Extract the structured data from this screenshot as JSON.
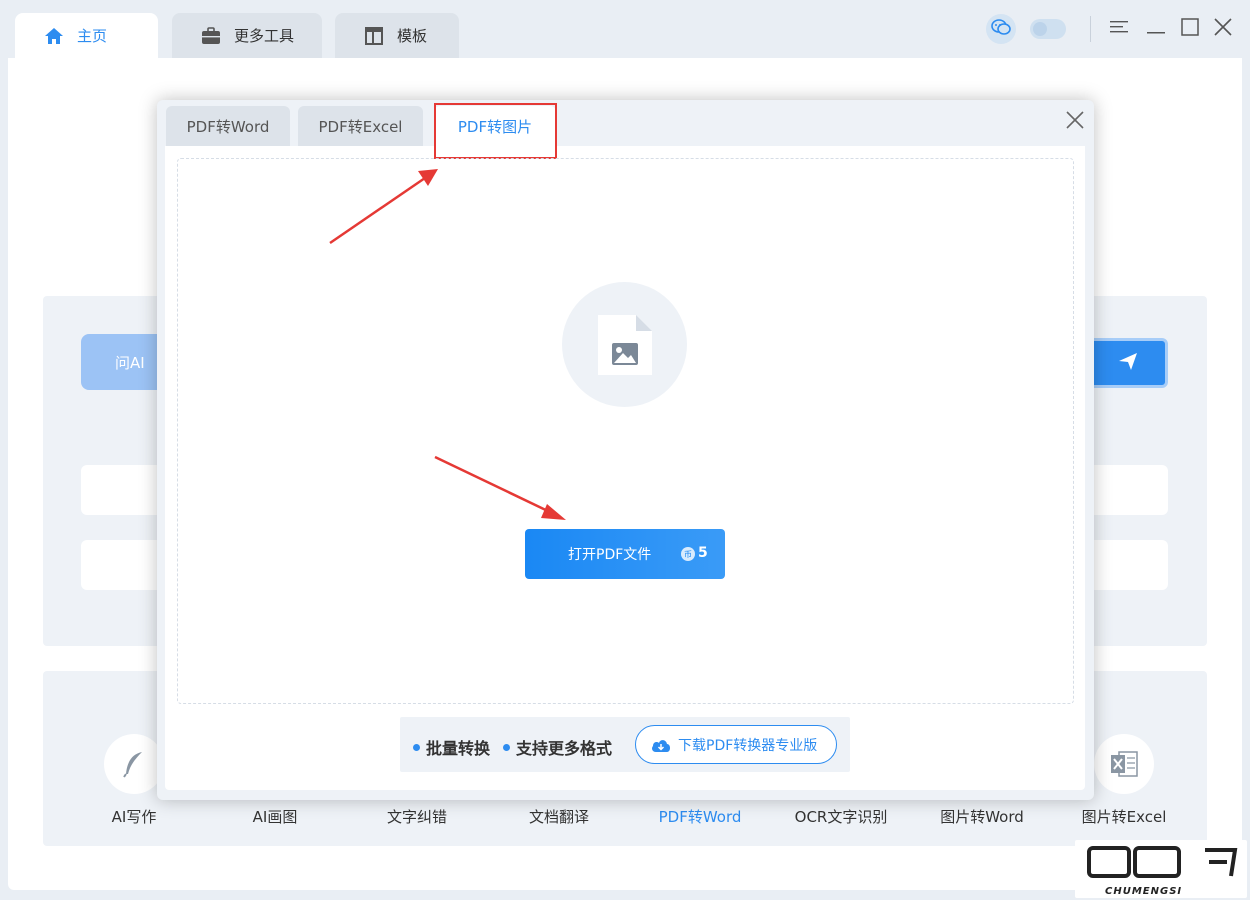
{
  "top_tabs": [
    {
      "label": "主页",
      "icon": "home-icon",
      "active": true
    },
    {
      "label": "更多工具",
      "icon": "toolbox-icon",
      "active": false
    },
    {
      "label": "模板",
      "icon": "template-icon",
      "active": false
    }
  ],
  "window_controls": [
    "wechat-icon",
    "toggle",
    "menu-icon",
    "minimize-icon",
    "maximize-icon",
    "close-icon"
  ],
  "main": {
    "ask_ai_label": "问AI",
    "tools": [
      {
        "label": "AI写作",
        "icon": "feather-icon"
      },
      {
        "label": "AI画图",
        "icon": "paint-icon"
      },
      {
        "label": "文字纠错",
        "icon": "check-icon"
      },
      {
        "label": "文档翻译",
        "icon": "translate-icon"
      },
      {
        "label": "PDF转Word",
        "icon": "pdf-word-icon"
      },
      {
        "label": "OCR文字识别",
        "icon": "ocr-icon"
      },
      {
        "label": "图片转Word",
        "icon": "image-word-icon"
      },
      {
        "label": "图片转Excel",
        "icon": "excel-icon"
      }
    ]
  },
  "modal": {
    "tabs": [
      "PDF转Word",
      "PDF转Excel",
      "PDF转图片"
    ],
    "active_tab": "PDF转图片",
    "open_button_label": "打开PDF文件",
    "coin_symbol": "币",
    "cost": "5",
    "features": [
      "批量转换",
      "支持更多格式"
    ],
    "download_label": "下载PDF转换器专业版"
  },
  "watermark": {
    "text": "CHUMENGSI"
  },
  "colors": {
    "accent": "#2d8cf0",
    "annotation": "#e53935",
    "background": "#e9eef4"
  }
}
